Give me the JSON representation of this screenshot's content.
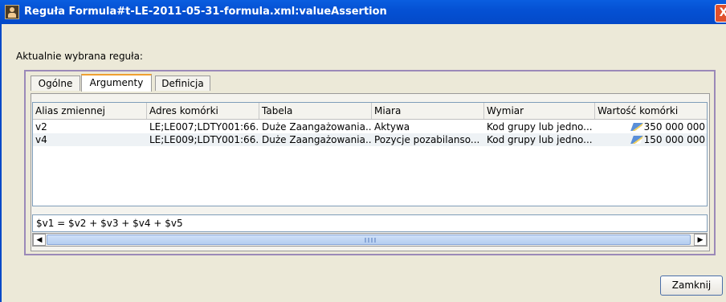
{
  "window": {
    "title": "Reguła Formula#t-LE-2011-05-31-formula.xml:valueAssertion",
    "close_glyph": "X"
  },
  "current_rule_label": "Aktualnie wybrana reguła:",
  "tabs": [
    {
      "label": "Ogólne",
      "active": false
    },
    {
      "label": "Argumenty",
      "active": true
    },
    {
      "label": "Definicja",
      "active": false
    }
  ],
  "table": {
    "columns": [
      "Alias zmiennej",
      "Adres komórki",
      "Tabela",
      "Miara",
      "Wymiar",
      "Wartość komórki"
    ],
    "rows": [
      {
        "alias": "v2",
        "address": "LE;LE007;LDTY001:66...",
        "table": "Duże Zaangażowania...",
        "measure": "Aktywa",
        "dimension": "Kod grupy lub jedno...",
        "value": "350 000 000"
      },
      {
        "alias": "v4",
        "address": "LE;LE009;LDTY001:66...",
        "table": "Duże Zaangażowania...",
        "measure": "Pozycje pozabilanso...",
        "dimension": "Kod grupy lub jedno...",
        "value": "150 000 000"
      }
    ]
  },
  "formula_text": "$v1 = $v2 + $v3 + $v4 + $v5",
  "close_button_label": "Zamknij",
  "colors": {
    "titlebar": "#0551d4",
    "frame_accent": "#9b89b8",
    "active_tab_accent": "#f0a030"
  }
}
